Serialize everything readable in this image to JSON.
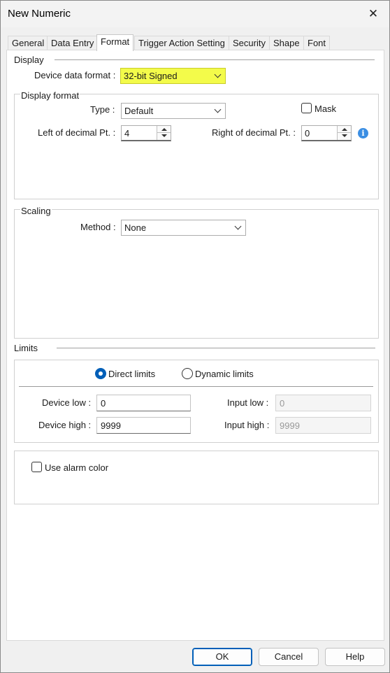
{
  "window": {
    "title": "New Numeric",
    "close_icon": "close-icon"
  },
  "tabs": [
    {
      "label": "General"
    },
    {
      "label": "Data Entry"
    },
    {
      "label": "Format"
    },
    {
      "label": "Trigger Action Setting"
    },
    {
      "label": "Security"
    },
    {
      "label": "Shape"
    },
    {
      "label": "Font"
    }
  ],
  "active_tab": "Format",
  "display": {
    "section_label": "Display",
    "device_data_format_label": "Device data format :",
    "device_data_format_value": "32-bit Signed",
    "highlight_color": "#f3fb4a"
  },
  "display_format": {
    "group_label": "Display format",
    "type_label": "Type :",
    "type_value": "Default",
    "mask_label": "Mask",
    "mask_checked": false,
    "left_decimal_label": "Left of decimal Pt. :",
    "left_decimal_value": "4",
    "right_decimal_label": "Right of decimal Pt. :",
    "right_decimal_value": "0",
    "info_icon": "i"
  },
  "scaling": {
    "group_label": "Scaling",
    "method_label": "Method :",
    "method_value": "None"
  },
  "limits": {
    "section_label": "Limits",
    "direct_limits_label": "Direct limits",
    "dynamic_limits_label": "Dynamic limits",
    "selected": "Direct limits",
    "device_low_label": "Device low :",
    "device_low_value": "0",
    "device_high_label": "Device high :",
    "device_high_value": "9999",
    "input_low_label": "Input low :",
    "input_low_value": "0",
    "input_high_label": "Input high :",
    "input_high_value": "9999"
  },
  "alarm": {
    "use_alarm_color_label": "Use alarm color",
    "checked": false
  },
  "buttons": {
    "ok": "OK",
    "cancel": "Cancel",
    "help": "Help"
  },
  "colors": {
    "accent": "#005fb8",
    "info": "#3b8ee3"
  }
}
